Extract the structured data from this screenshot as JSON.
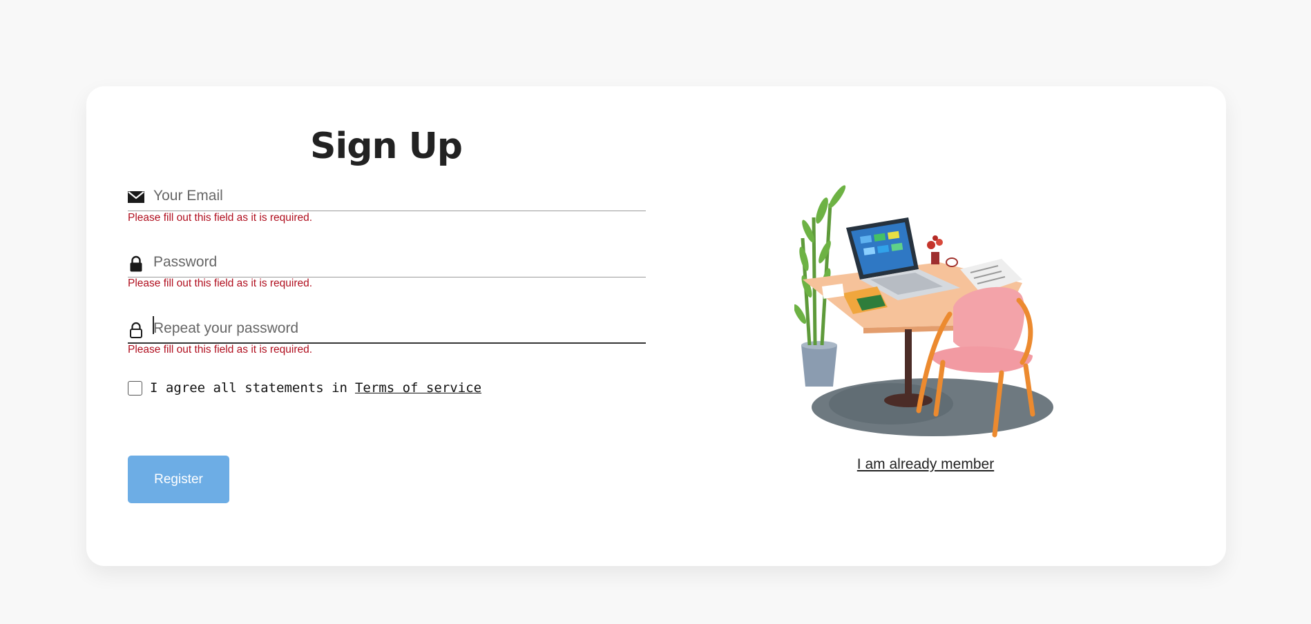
{
  "form": {
    "title": "Sign Up",
    "email": {
      "placeholder": "Your Email",
      "value": "",
      "error": "Please fill out this field as it is required."
    },
    "password": {
      "placeholder": "Password",
      "value": "",
      "error": "Please fill out this field as it is required."
    },
    "repeat_password": {
      "placeholder": "Repeat your password",
      "value": "",
      "error": "Please fill out this field as it is required.",
      "focused": true
    },
    "agree": {
      "checked": false,
      "text": "I agree all statements in",
      "link": "Terms of service"
    },
    "register_label": "Register"
  },
  "side": {
    "illustration": "desk-illustration",
    "member_link": "I am already member"
  },
  "colors": {
    "error": "#b00e1e",
    "register_button": "#6dade5",
    "background": "#f8f8f8",
    "card": "#ffffff"
  }
}
